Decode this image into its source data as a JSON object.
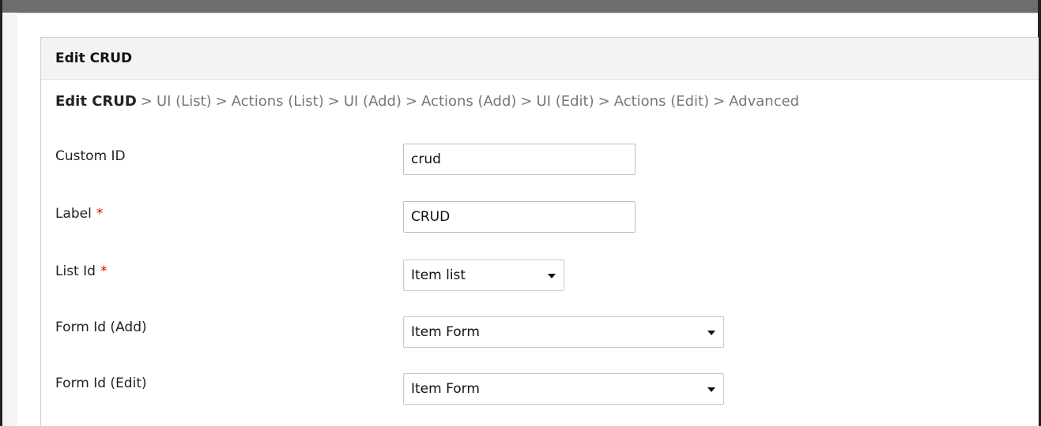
{
  "dialog": {
    "title": "Edit CRUD",
    "breadcrumb": [
      "Edit CRUD",
      "UI (List)",
      "Actions (List)",
      "UI (Add)",
      "Actions (Add)",
      "UI (Edit)",
      "Actions (Edit)",
      "Advanced"
    ],
    "breadcrumb_separator": ">"
  },
  "form": {
    "custom_id": {
      "label": "Custom ID",
      "value": "crud"
    },
    "label_field": {
      "label": "Label",
      "required_mark": "*",
      "value": "CRUD"
    },
    "list_id": {
      "label": "List Id",
      "required_mark": "*",
      "selected": "Item list"
    },
    "form_id_add": {
      "label": "Form Id (Add)",
      "selected": "Item Form"
    },
    "form_id_edit": {
      "label": "Form Id (Edit)",
      "selected": "Item Form"
    }
  },
  "colors": {
    "required": "#e00000",
    "header_bg": "#f3f3f3"
  }
}
